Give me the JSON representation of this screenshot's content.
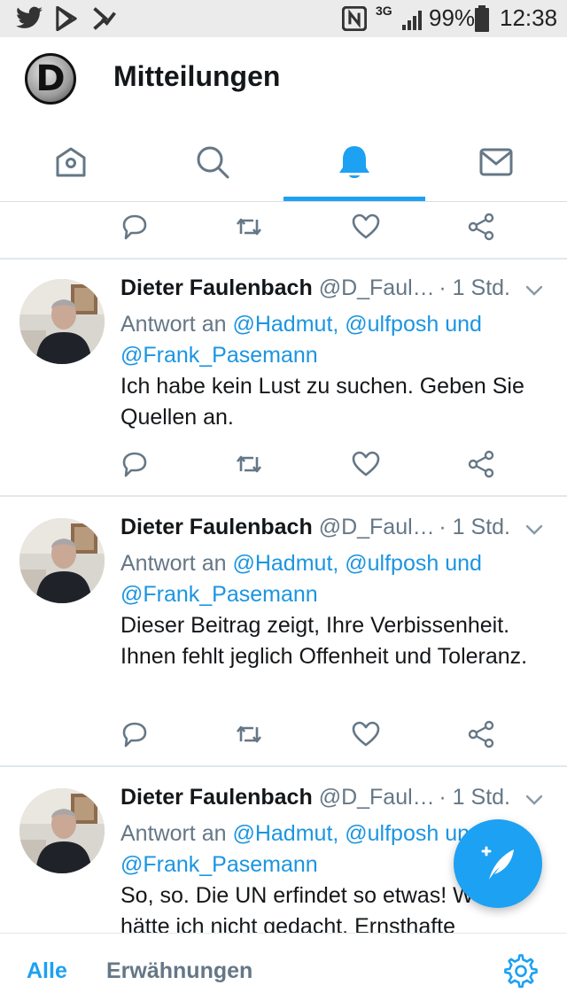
{
  "statusbar": {
    "icons": [
      "twitter-icon",
      "play-store-icon",
      "checkmark-app-icon",
      "nfc-icon",
      "signal-icon",
      "battery-icon"
    ],
    "network": "3G",
    "battery": "99%",
    "time": "12:38"
  },
  "header": {
    "logo_letter": "D",
    "title": "Mitteilungen"
  },
  "tabs": [
    {
      "name": "home",
      "icon": "home-icon",
      "active": false
    },
    {
      "name": "search",
      "icon": "search-icon",
      "active": false
    },
    {
      "name": "notifications",
      "icon": "bell-icon",
      "active": true
    },
    {
      "name": "messages",
      "icon": "mail-icon",
      "active": false
    }
  ],
  "colors": {
    "accent": "#1da1f2",
    "mention": "#1b95e0",
    "secondary_text": "#657786",
    "divider": "#e1e8ed"
  },
  "tweets": [
    {
      "name": "Dieter Faulenbach",
      "handle": "@D_Faul…",
      "time": "· 1 Std.",
      "reply_prefix": "Antwort an",
      "reply_mentions": "@Hadmut, @ulfposh und @Frank_Pasemann",
      "text": "Ich habe kein Lust zu suchen.  Geben Sie Quellen an."
    },
    {
      "name": "Dieter Faulenbach",
      "handle": "@D_Faul…",
      "time": "· 1 Std.",
      "reply_prefix": "Antwort an",
      "reply_mentions": "@Hadmut, @ulfposh und @Frank_Pasemann",
      "text": "Dieser Beitrag zeigt, Ihre Verbissenheit. Ihnen fehlt jeglich Offenheit und Toleranz."
    },
    {
      "name": "Dieter Faulenbach",
      "handle": "@D_Faul…",
      "time": "· 1 Std.",
      "reply_prefix": "Antwort an",
      "reply_mentions": "@Hadmut, @ulfposh und @Frank_Pasemann",
      "text": "So, so. Die UN erfindet so etwas! Wow, hätte ich nicht gedacht. Ernsthafte"
    }
  ],
  "bottom": {
    "all_label": "Alle",
    "mentions_label": "Erwähnungen"
  }
}
